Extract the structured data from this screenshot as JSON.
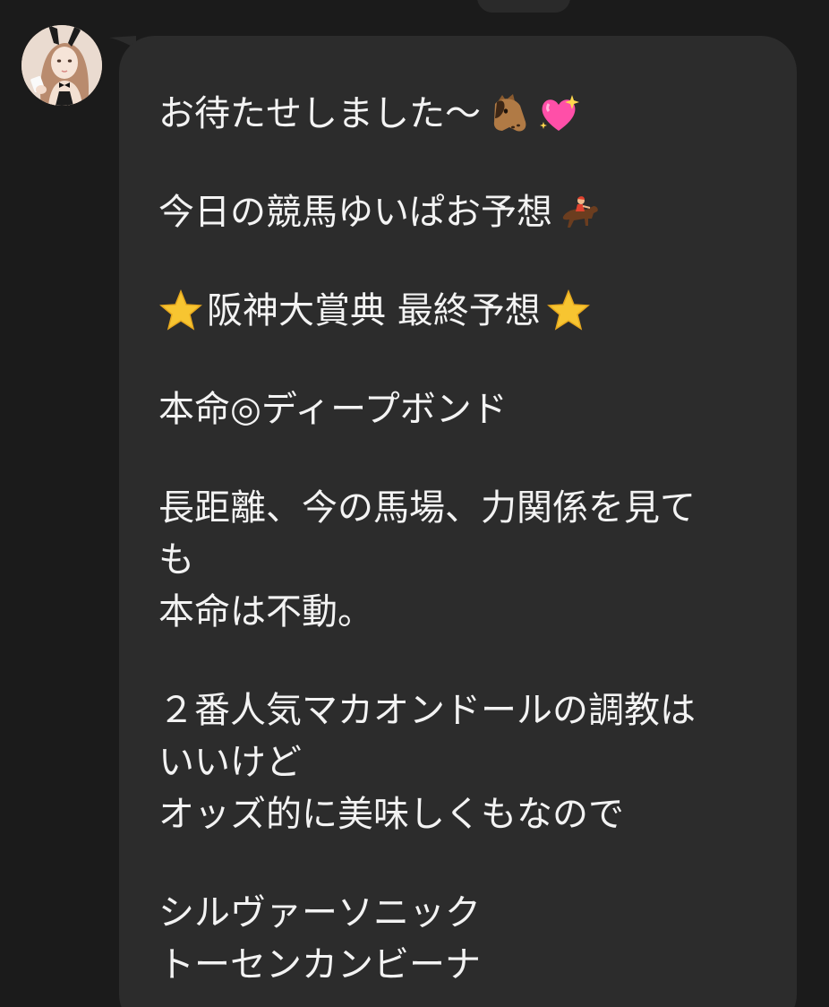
{
  "message": {
    "greeting": "お待たせしました〜",
    "title": "今日の競馬ゆいぱお予想",
    "race": "阪神大賞典 最終予想",
    "pick": "本命◎ディープボンド",
    "reason_1a": "長距離、今の馬場、力関係を見て",
    "reason_1b": "も",
    "reason_1c": "本命は不動。",
    "reason_2a": "２番人気マカオンドールの調教は",
    "reason_2b": "いいけど",
    "reason_2c": "オッズ的に美味しくもなので",
    "horse_1": "シルヴァーソニック",
    "horse_2": "トーセンカンビーナ"
  },
  "icons": {
    "horse_face": "horse-face-icon",
    "sparkling_heart": "sparkling-heart-icon",
    "horse_racing": "horse-racing-icon",
    "star": "star-icon",
    "avatar": "avatar"
  },
  "colors": {
    "background": "#1b1b1b",
    "bubble": "#2c2c2c",
    "text": "#f3f3f3",
    "star": "#f7c531",
    "heart": "#ff4fa8"
  }
}
